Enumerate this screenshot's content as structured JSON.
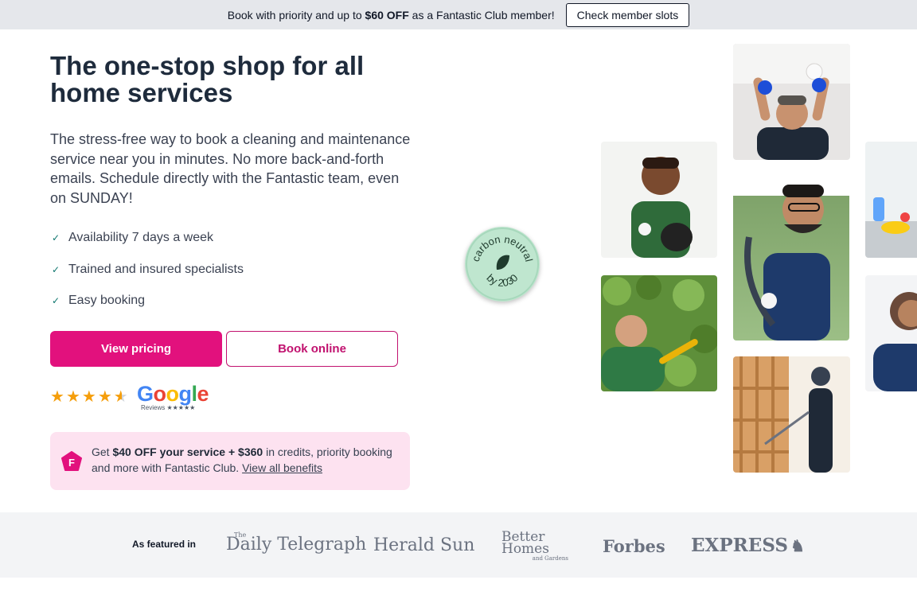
{
  "topbar": {
    "text_before": "Book with priority and up to ",
    "highlight": "$60 OFF",
    "text_after": " as a Fantastic Club member!",
    "button_label": "Check member slots"
  },
  "hero": {
    "title": "The one-stop shop for all home services",
    "lead": "The stress-free way to book a cleaning and maintenance service near you in minutes. No more back-and-forth emails. Schedule directly with the Fantastic team, even on SUNDAY!",
    "features": [
      "Availability 7 days a week",
      "Trained and insured specialists",
      "Easy booking"
    ],
    "primary_button": "View pricing",
    "secondary_button": "Book online"
  },
  "rating": {
    "stars": 4.5,
    "max_stars": 5,
    "google_word": "Google",
    "google_reviews": "Reviews ★★★★★"
  },
  "promo": {
    "prefix": "Get ",
    "bold": "$40 OFF your service + $360",
    "middle": " in credits, priority booking and more with Fantastic Club. ",
    "link": "View all benefits"
  },
  "seal": {
    "top_text": "carbon neutral",
    "bottom_text": "by 2030"
  },
  "featured": {
    "label": "As featured in",
    "logos": [
      "Daily Telegraph",
      "Herald Sun",
      "Better Homes",
      "Forbes",
      "EXPRESS"
    ],
    "logo_small_text": [
      "The",
      "and Gardens"
    ]
  },
  "colors": {
    "brand_pink": "#e2117d",
    "title_navy": "#1e2b3c",
    "promo_bg": "#fde2f0",
    "seal_green": "#bfe6cf"
  }
}
